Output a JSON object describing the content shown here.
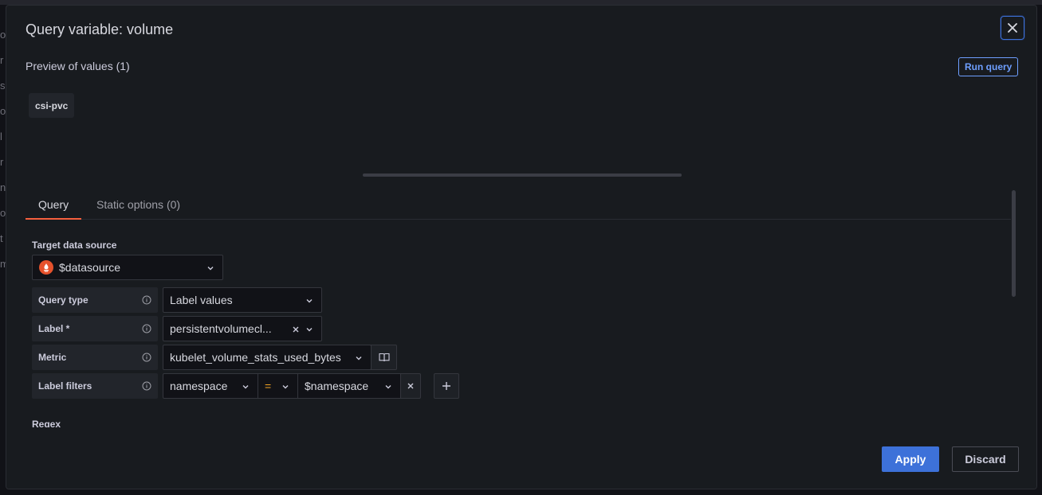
{
  "modal": {
    "title": "Query variable: volume",
    "preview_title": "Preview of values (1)",
    "run_query_label": "Run query",
    "preview_values": [
      "csi-pvc"
    ]
  },
  "tabs": [
    {
      "label": "Query",
      "active": true
    },
    {
      "label": "Static options (0)",
      "active": false
    }
  ],
  "form": {
    "target_datasource_label": "Target data source",
    "datasource_value": "$datasource",
    "query_type_label": "Query type",
    "query_type_value": "Label values",
    "label_label": "Label *",
    "label_value": "persistentvolumecl...",
    "metric_label": "Metric",
    "metric_value": "kubelet_volume_stats_used_bytes",
    "label_filters_label": "Label filters",
    "filter_key": "namespace",
    "filter_op": "=",
    "filter_value": "$namespace",
    "regex_label": "Regex"
  },
  "footer": {
    "apply_label": "Apply",
    "discard_label": "Discard"
  },
  "colors": {
    "primary": "#3d71d9",
    "tab_active": "#f55f3e",
    "operator": "#f5a623",
    "prometheus": "#e6522c"
  }
}
